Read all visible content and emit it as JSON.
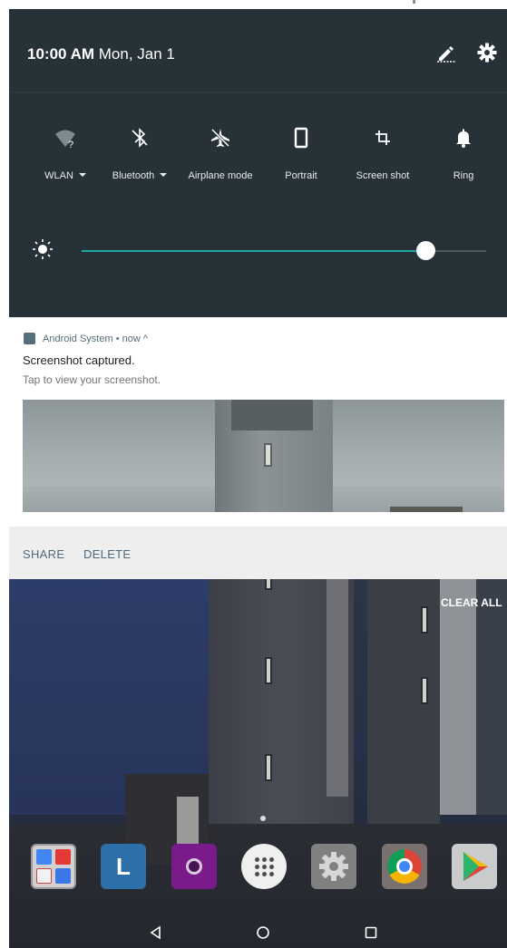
{
  "quick_settings": {
    "time": "10:00 AM",
    "date": "Mon, Jan 1",
    "edit_icon": "edit-icon",
    "settings_icon": "gear-icon",
    "tiles": [
      {
        "label": "WLAN",
        "icon": "wifi-unknown-icon",
        "has_dropdown": true
      },
      {
        "label": "Bluetooth",
        "icon": "bluetooth-disabled-icon",
        "has_dropdown": true
      },
      {
        "label": "Airplane mode",
        "icon": "airplane-disabled-icon",
        "has_dropdown": false
      },
      {
        "label": "Portrait",
        "icon": "portrait-icon",
        "has_dropdown": false
      },
      {
        "label": "Screen shot",
        "icon": "crop-icon",
        "has_dropdown": false
      },
      {
        "label": "Ring",
        "icon": "bell-icon",
        "has_dropdown": false
      }
    ],
    "brightness": {
      "level": 0.85,
      "icon": "brightness-icon"
    },
    "background_color": "#263238",
    "accent_color": "#1fa9a0"
  },
  "notification": {
    "app_name": "Android System",
    "separator": "•",
    "time": "now",
    "expand_glyph": "^",
    "title": "Screenshot captured.",
    "text": "Tap to view your screenshot.",
    "actions": {
      "share": "SHARE",
      "delete": "DELETE"
    }
  },
  "home": {
    "clear_all": "CLEAR ALL",
    "dock_apps": [
      {
        "name": "folder",
        "icon": "app-folder-icon"
      },
      {
        "name": "lenovo",
        "icon": "lenovo-launcher-icon",
        "glyph": "L"
      },
      {
        "name": "camera",
        "icon": "camera-icon"
      },
      {
        "name": "app-drawer",
        "icon": "app-drawer-icon"
      },
      {
        "name": "settings",
        "icon": "gear-icon"
      },
      {
        "name": "chrome",
        "icon": "chrome-icon"
      },
      {
        "name": "play-store",
        "icon": "play-store-icon"
      }
    ]
  },
  "navbar": {
    "back": "back-icon",
    "home": "home-icon",
    "recents": "recents-icon"
  }
}
